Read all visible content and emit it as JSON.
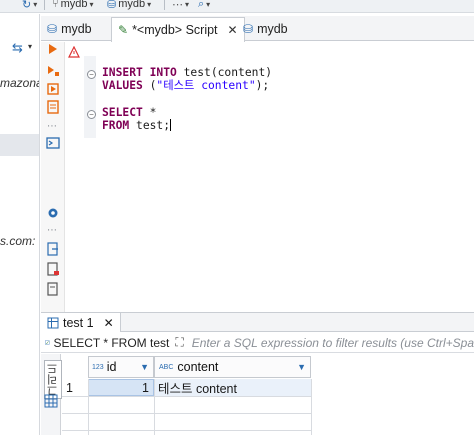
{
  "toolbar": {
    "datasource1": "mydb",
    "datasource2": "mydb"
  },
  "left_pane": {
    "text_top": "mazona",
    "text_bottom": "s.com:"
  },
  "tabs": [
    {
      "label": "mydb"
    },
    {
      "label": "*<mydb> Script",
      "close": "✕"
    },
    {
      "label": "mydb"
    }
  ],
  "editor": {
    "lines": [
      {
        "parts": [
          {
            "t": "INSERT INTO",
            "c": "kw"
          },
          {
            "t": " test(content)",
            "c": ""
          }
        ]
      },
      {
        "parts": [
          {
            "t": "VALUES",
            "c": "kw"
          },
          {
            "t": " (",
            "c": ""
          },
          {
            "t": "\"테스트 content\"",
            "c": "str"
          },
          {
            "t": ");",
            "c": ""
          }
        ]
      },
      {
        "parts": []
      },
      {
        "parts": [
          {
            "t": "SELECT",
            "c": "kw"
          },
          {
            "t": " *",
            "c": ""
          }
        ]
      },
      {
        "parts": [
          {
            "t": "FROM",
            "c": "kw"
          },
          {
            "t": " test;",
            "c": ""
          }
        ]
      }
    ]
  },
  "results": {
    "tab_label": "test 1",
    "tab_close": "✕",
    "sql": "SELECT * FROM test",
    "filter_placeholder": "Enter a SQL expression to filter results (use Ctrl+Spa",
    "side_label": "그리드",
    "columns": [
      {
        "type_badge": "123",
        "name": "id"
      },
      {
        "type_badge": "ABC",
        "name": "content"
      }
    ],
    "rows": [
      {
        "num": "1",
        "id": "1",
        "content": "테스트 content"
      }
    ]
  },
  "colors": {
    "keyword": "#7f0055",
    "string": "#2a00ff",
    "accent": "#2b6cb0"
  }
}
